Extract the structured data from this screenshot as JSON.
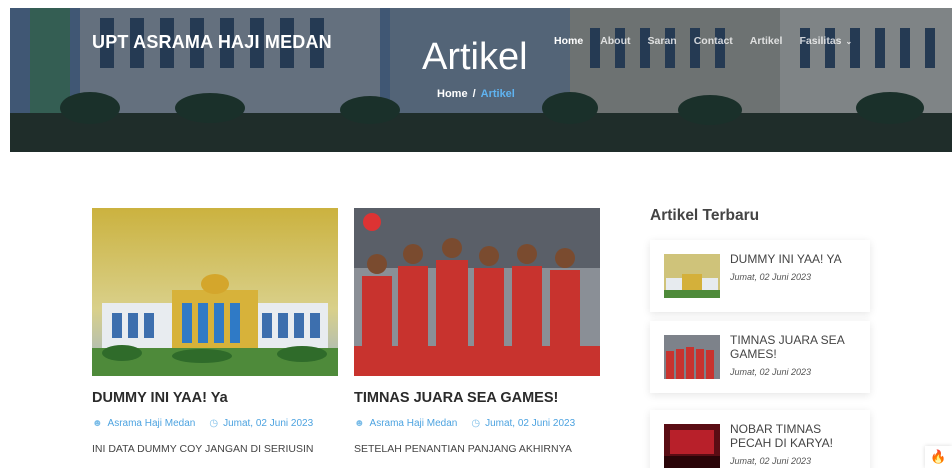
{
  "brand": "UPT ASRAMA HAJI MEDAN",
  "hero": {
    "title": "Artikel"
  },
  "breadcrumb": {
    "home": "Home",
    "separator": "/",
    "current": "Artikel"
  },
  "nav": {
    "items": [
      {
        "label": "Home"
      },
      {
        "label": "About"
      },
      {
        "label": "Saran"
      },
      {
        "label": "Contact"
      },
      {
        "label": "Artikel"
      },
      {
        "label": "Fasilitas"
      }
    ]
  },
  "posts": [
    {
      "title": "DUMMY INI YAA! Ya",
      "author": "Asrama Haji Medan",
      "date": "Jumat, 02 Juni 2023",
      "excerpt": "INI DATA DUMMY COY JANGAN DI SERIUSIN"
    },
    {
      "title": "TIMNAS JUARA SEA GAMES!",
      "author": "Asrama Haji Medan",
      "date": "Jumat, 02 Juni 2023",
      "excerpt": "SETELAH PENANTIAN PANJANG AKHIRNYA"
    }
  ],
  "sidebar": {
    "title": "Artikel Terbaru",
    "items": [
      {
        "title": "DUMMY INI YAA! Ya",
        "date": "Jumat, 02 Juni 2023"
      },
      {
        "title": "TIMNAS JUARA SEA GAMES!",
        "date": "Jumat, 02 Juni 2023"
      },
      {
        "title": "NOBAR TIMNAS PECAH DI KARYA!",
        "date": "Jumat, 02 Juni 2023"
      }
    ]
  },
  "icons": {
    "author": "user-icon",
    "date": "clock-icon",
    "dropdown": "chevron-down-icon",
    "floating": "flame-icon"
  },
  "colors": {
    "accent": "#4da3e0",
    "breadcrumb_current": "#5fb3f0",
    "flame": "#e84e1b"
  }
}
